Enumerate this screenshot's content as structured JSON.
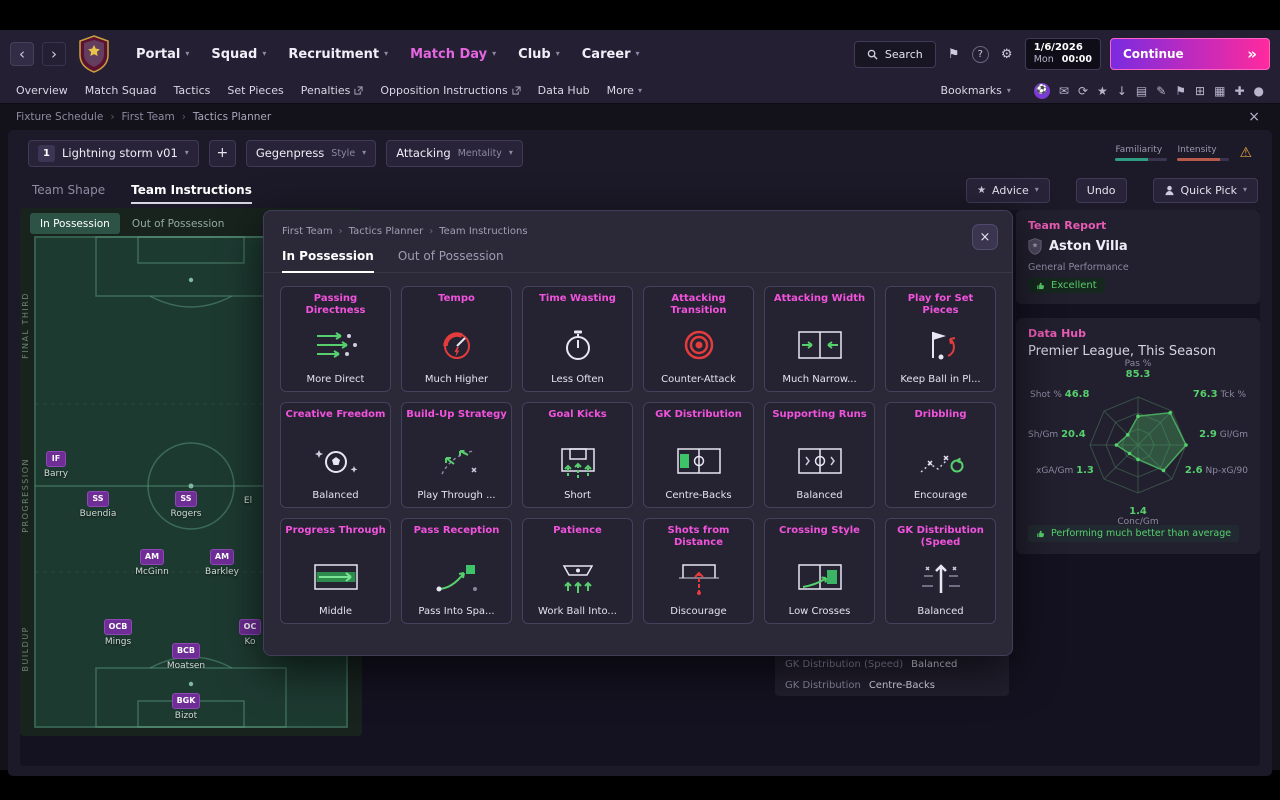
{
  "icons": {
    "back": "‹",
    "forward": "›",
    "chevron": "▾",
    "continue": "»",
    "close": "×",
    "warning": "⚠",
    "star": "★",
    "settings": "⚙",
    "bookmark": "⚑",
    "help": "?",
    "add": "+",
    "quick": [
      "⚽",
      "✉",
      "⟳",
      "★",
      "↓",
      "▤",
      "✎",
      "⚑",
      "⊞",
      "▦",
      "✚",
      "●"
    ]
  },
  "titlebar": {
    "nav": [
      "Portal",
      "Squad",
      "Recruitment",
      "Match Day",
      "Club",
      "Career"
    ],
    "search_label": "Search",
    "date": "1/6/2026",
    "day": "Mon",
    "time": "00:00",
    "continue_label": "Continue"
  },
  "subnav": {
    "items": [
      "Overview",
      "Match Squad",
      "Tactics",
      "Set Pieces",
      "Penalties",
      "Opposition Instructions",
      "Data Hub",
      "More"
    ],
    "bookmarks_label": "Bookmarks"
  },
  "breadcrumb": {
    "a": "Fixture Schedule",
    "b": "First Team",
    "c": "Tactics Planner"
  },
  "toolbar": {
    "tactic_number": "1",
    "tactic_name": "Lightning storm v01",
    "add_label": "+",
    "style_value": "Gegenpress",
    "style_label": "Style",
    "mentality_value": "Attacking",
    "mentality_label": "Mentality",
    "familiarity_label": "Familiarity",
    "intensity_label": "Intensity"
  },
  "tabsrow": {
    "team_shape": "Team Shape",
    "team_instructions": "Team Instructions",
    "advice_label": "Advice",
    "undo_label": "Undo",
    "quick_pick_label": "Quick Pick"
  },
  "pitch": {
    "tab_in": "In Possession",
    "tab_out": "Out of Possession",
    "zones": [
      "FINAL THIRD",
      "PROGRESSION",
      "BUILDUP"
    ],
    "players": [
      {
        "pos": "IF",
        "name": "Barry"
      },
      {
        "pos": "SS",
        "name": "Buendia"
      },
      {
        "pos": "SS",
        "name": "Rogers"
      },
      {
        "pos": "",
        "name": "El"
      },
      {
        "pos": "AM",
        "name": "McGinn"
      },
      {
        "pos": "AM",
        "name": "Barkley"
      },
      {
        "pos": "OCB",
        "name": "Mings"
      },
      {
        "pos": "OC",
        "name": "Ko"
      },
      {
        "pos": "BCB",
        "name": "Moatsen"
      },
      {
        "pos": "BGK",
        "name": "Bizot"
      }
    ]
  },
  "modal": {
    "breadcrumb": {
      "a": "First Team",
      "b": "Tactics Planner",
      "c": "Team Instructions"
    },
    "tab_in": "In Possession",
    "tab_out": "Out of Possession",
    "cards": [
      {
        "title": "Passing Directness",
        "value": "More Direct"
      },
      {
        "title": "Tempo",
        "value": "Much Higher"
      },
      {
        "title": "Time Wasting",
        "value": "Less Often"
      },
      {
        "title": "Attacking Transition",
        "value": "Counter-Attack"
      },
      {
        "title": "Attacking Width",
        "value": "Much Narrow..."
      },
      {
        "title": "Play for Set Pieces",
        "value": "Keep Ball in Pl..."
      },
      {
        "title": "Creative Freedom",
        "value": "Balanced"
      },
      {
        "title": "Build-Up Strategy",
        "value": "Play Through ..."
      },
      {
        "title": "Goal Kicks",
        "value": "Short"
      },
      {
        "title": "GK Distribution",
        "value": "Centre-Backs"
      },
      {
        "title": "Supporting Runs",
        "value": "Balanced"
      },
      {
        "title": "Dribbling",
        "value": "Encourage"
      },
      {
        "title": "Progress Through",
        "value": "Middle"
      },
      {
        "title": "Pass Reception",
        "value": "Pass Into Spa..."
      },
      {
        "title": "Patience",
        "value": "Work Ball Into..."
      },
      {
        "title": "Shots from Distance",
        "value": "Discourage"
      },
      {
        "title": "Crossing Style",
        "value": "Low Crosses"
      },
      {
        "title": "GK Distribution (Speed",
        "value": "Balanced"
      }
    ]
  },
  "background_list": {
    "rows": [
      {
        "label": "GK Distribution (Speed)",
        "value": "Balanced"
      },
      {
        "label": "GK Distribution",
        "value": "Centre-Backs"
      }
    ]
  },
  "team_report": {
    "title": "Team Report",
    "team": "Aston Villa",
    "subtitle": "General Performance",
    "rating": "Excellent"
  },
  "data_hub": {
    "title": "Data Hub",
    "subtitle": "Premier League, This Season",
    "stats": {
      "pas": {
        "label": "Pas %",
        "value": "85.3"
      },
      "shot": {
        "label": "Shot %",
        "value": "46.8"
      },
      "tck": {
        "label": "Tck %",
        "value": "76.3"
      },
      "shgm": {
        "label": "Sh/Gm",
        "value": "20.4"
      },
      "glgm": {
        "label": "Gl/Gm",
        "value": "2.9"
      },
      "xga": {
        "label": "xGA/Gm",
        "value": "1.3"
      },
      "npxg": {
        "label": "Np-xG/90",
        "value": "2.6"
      },
      "conc": {
        "label": "Conc/Gm",
        "value": "1.4"
      }
    },
    "footer": "Performing much better than average"
  },
  "chart_data": {
    "type": "radar",
    "title": "Premier League, This Season",
    "axes": [
      "Pas %",
      "Tck %",
      "Gl/Gm",
      "Np-xG/90",
      "Conc/Gm",
      "xGA/Gm",
      "Sh/Gm",
      "Shot %"
    ],
    "values": [
      85.3,
      76.3,
      2.9,
      2.6,
      1.4,
      1.3,
      20.4,
      46.8
    ],
    "legend_position": "around",
    "grid": true
  }
}
